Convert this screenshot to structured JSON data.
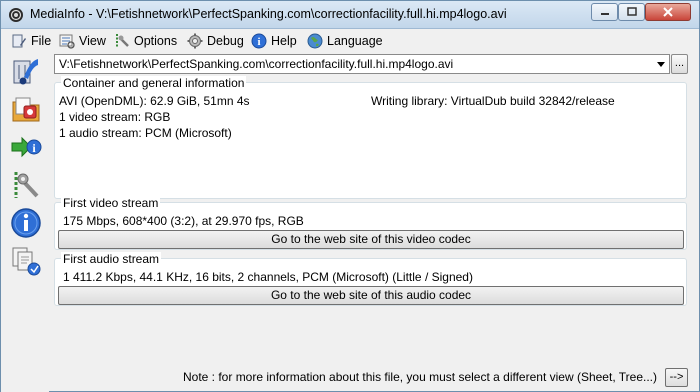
{
  "window": {
    "title": "MediaInfo - V:\\Fetishnetwork\\PerfectSpanking.com\\correctionfacility.full.hi.mp4logo.avi"
  },
  "menu": {
    "items": [
      {
        "label": "File",
        "icon": "file-icon"
      },
      {
        "label": "View",
        "icon": "view-icon"
      },
      {
        "label": "Options",
        "icon": "options-icon"
      },
      {
        "label": "Debug",
        "icon": "debug-icon"
      },
      {
        "label": "Help",
        "icon": "help-icon"
      },
      {
        "label": "Language",
        "icon": "globe-icon"
      }
    ]
  },
  "toolbar": {
    "tools": [
      "open-file-icon",
      "open-folder-icon",
      "export-icon",
      "preferences-icon",
      "about-icon",
      "copy-icon"
    ]
  },
  "file_select": {
    "value": "V:\\Fetishnetwork\\PerfectSpanking.com\\correctionfacility.full.hi.mp4logo.avi",
    "browse_label": "..."
  },
  "general": {
    "title": "Container and general information",
    "format_line": "AVI (OpenDML): 62.9 GiB, 51mn 4s",
    "writing_library": "Writing library: VirtualDub build 32842/release",
    "video_count": "1 video stream: RGB",
    "audio_count": "1 audio stream: PCM (Microsoft)"
  },
  "video": {
    "title": "First video stream",
    "info": "175 Mbps, 608*400 (3:2), at 29.970 fps, RGB",
    "button_label": "Go to the web site of this video codec"
  },
  "audio": {
    "title": "First audio stream",
    "info": "1 411.2 Kbps, 44.1 KHz, 16 bits, 2 channels, PCM (Microsoft) (Little / Signed)",
    "button_label": "Go to the web site of this audio codec"
  },
  "footer": {
    "note": "Note : for more information about this file, you must select a different view (Sheet, Tree...)",
    "next_label": "-->"
  }
}
